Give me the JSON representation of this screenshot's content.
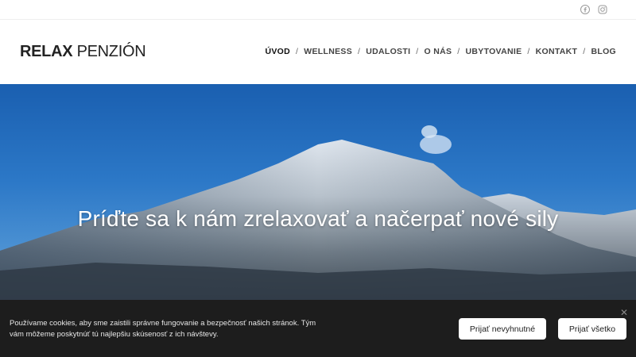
{
  "social": {
    "icons": [
      "facebook-icon",
      "instagram-icon"
    ]
  },
  "logo": {
    "bold": "RELAX",
    "rest": "PENZIÓN"
  },
  "nav": {
    "items": [
      "ÚVOD",
      "WELLNESS",
      "UDALOSTI",
      "O NÁS",
      "UBYTOVANIE",
      "KONTAKT",
      "BLOG"
    ],
    "separator": "/",
    "active_index": 0
  },
  "hero": {
    "title": "Príďte sa k nám zrelaxovať a načerpať nové sily"
  },
  "cookie": {
    "text": "Používame cookies, aby sme zaistili správne fungovanie a bezpečnosť našich stránok. Tým vám môžeme poskytnúť tú najlepšiu skúsenosť z ich návštevy.",
    "btn_necessary": "Prijať nevyhnutné",
    "btn_all": "Prijať všetko",
    "close_icon": "close-icon"
  },
  "colors": {
    "cookie_bg": "#1d1d1d",
    "sky": "#2c78c7",
    "text_dark": "#222222"
  }
}
